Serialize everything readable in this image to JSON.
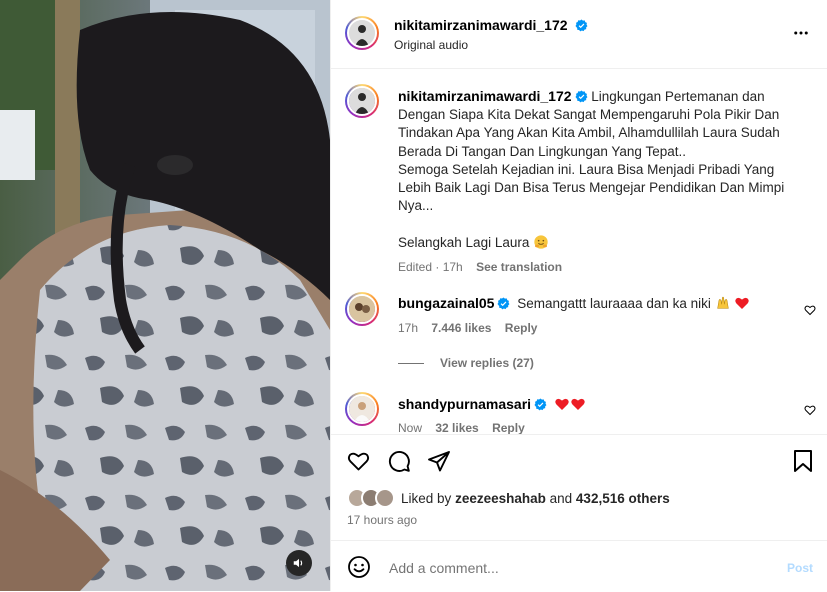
{
  "post": {
    "author": "nikitamirzanimawardi_172",
    "audio": "Original audio"
  },
  "caption": {
    "author": "nikitamirzanimawardi_172",
    "paragraph1": "Lingkungan Pertemanan dan Dengan Siapa Kita Dekat Sangat Mempengaruhi Pola Pikir Dan Tindakan Apa Yang Akan Kita Ambil, Alhamdullilah Laura Sudah Berada Di Tangan Dan Lingkungan Yang Tepat..",
    "paragraph2": "Semoga Setelah Kejadian ini. Laura Bisa Menjadi Pribadi Yang Lebih Baik Lagi Dan Bisa Terus Mengejar Pendidikan Dan Mimpi Nya...",
    "paragraph3": "Selangkah Lagi Laura",
    "edited": "Edited · 17h",
    "see_translation": "See translation"
  },
  "comments": [
    {
      "user": "bungazainal05",
      "text": "Semangattt lauraaaa dan ka niki",
      "time": "17h",
      "likes": "7.446 likes",
      "reply": "Reply",
      "view_replies": "View replies (27)"
    },
    {
      "user": "shandypurnamasari",
      "text": "",
      "time": "Now",
      "likes": "32 likes",
      "reply": "Reply"
    }
  ],
  "likes": {
    "prefix": "Liked by",
    "user": "zeezeeshahab",
    "and": "and",
    "others": "432,516 others"
  },
  "timestamp": "17 hours ago",
  "add_comment": {
    "placeholder": "Add a comment...",
    "post_label": "Post"
  },
  "colors": {
    "verified": "#0095f6",
    "muted": "#737373",
    "heart": "#ed1c24"
  }
}
